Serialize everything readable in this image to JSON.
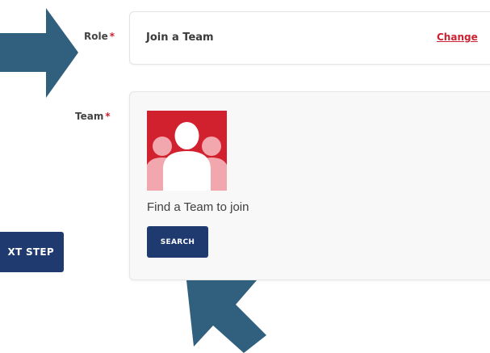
{
  "form": {
    "role": {
      "label": "Role",
      "required_mark": "*",
      "value": "Join a Team",
      "change_link": "Change"
    },
    "team": {
      "label": "Team",
      "required_mark": "*",
      "image_icon": "team-silhouette-icon",
      "prompt": "Find a Team to join",
      "search_button": "SEARCH"
    },
    "next_button": "XT STEP"
  },
  "annotations": {
    "arrows": [
      "arrow-right-icon",
      "arrow-up-icon"
    ]
  },
  "colors": {
    "primary_button": "#1e3a6e",
    "accent_red": "#cc2131",
    "annotation_arrow": "#315f7e",
    "team_image_bg": "#d1202e"
  }
}
